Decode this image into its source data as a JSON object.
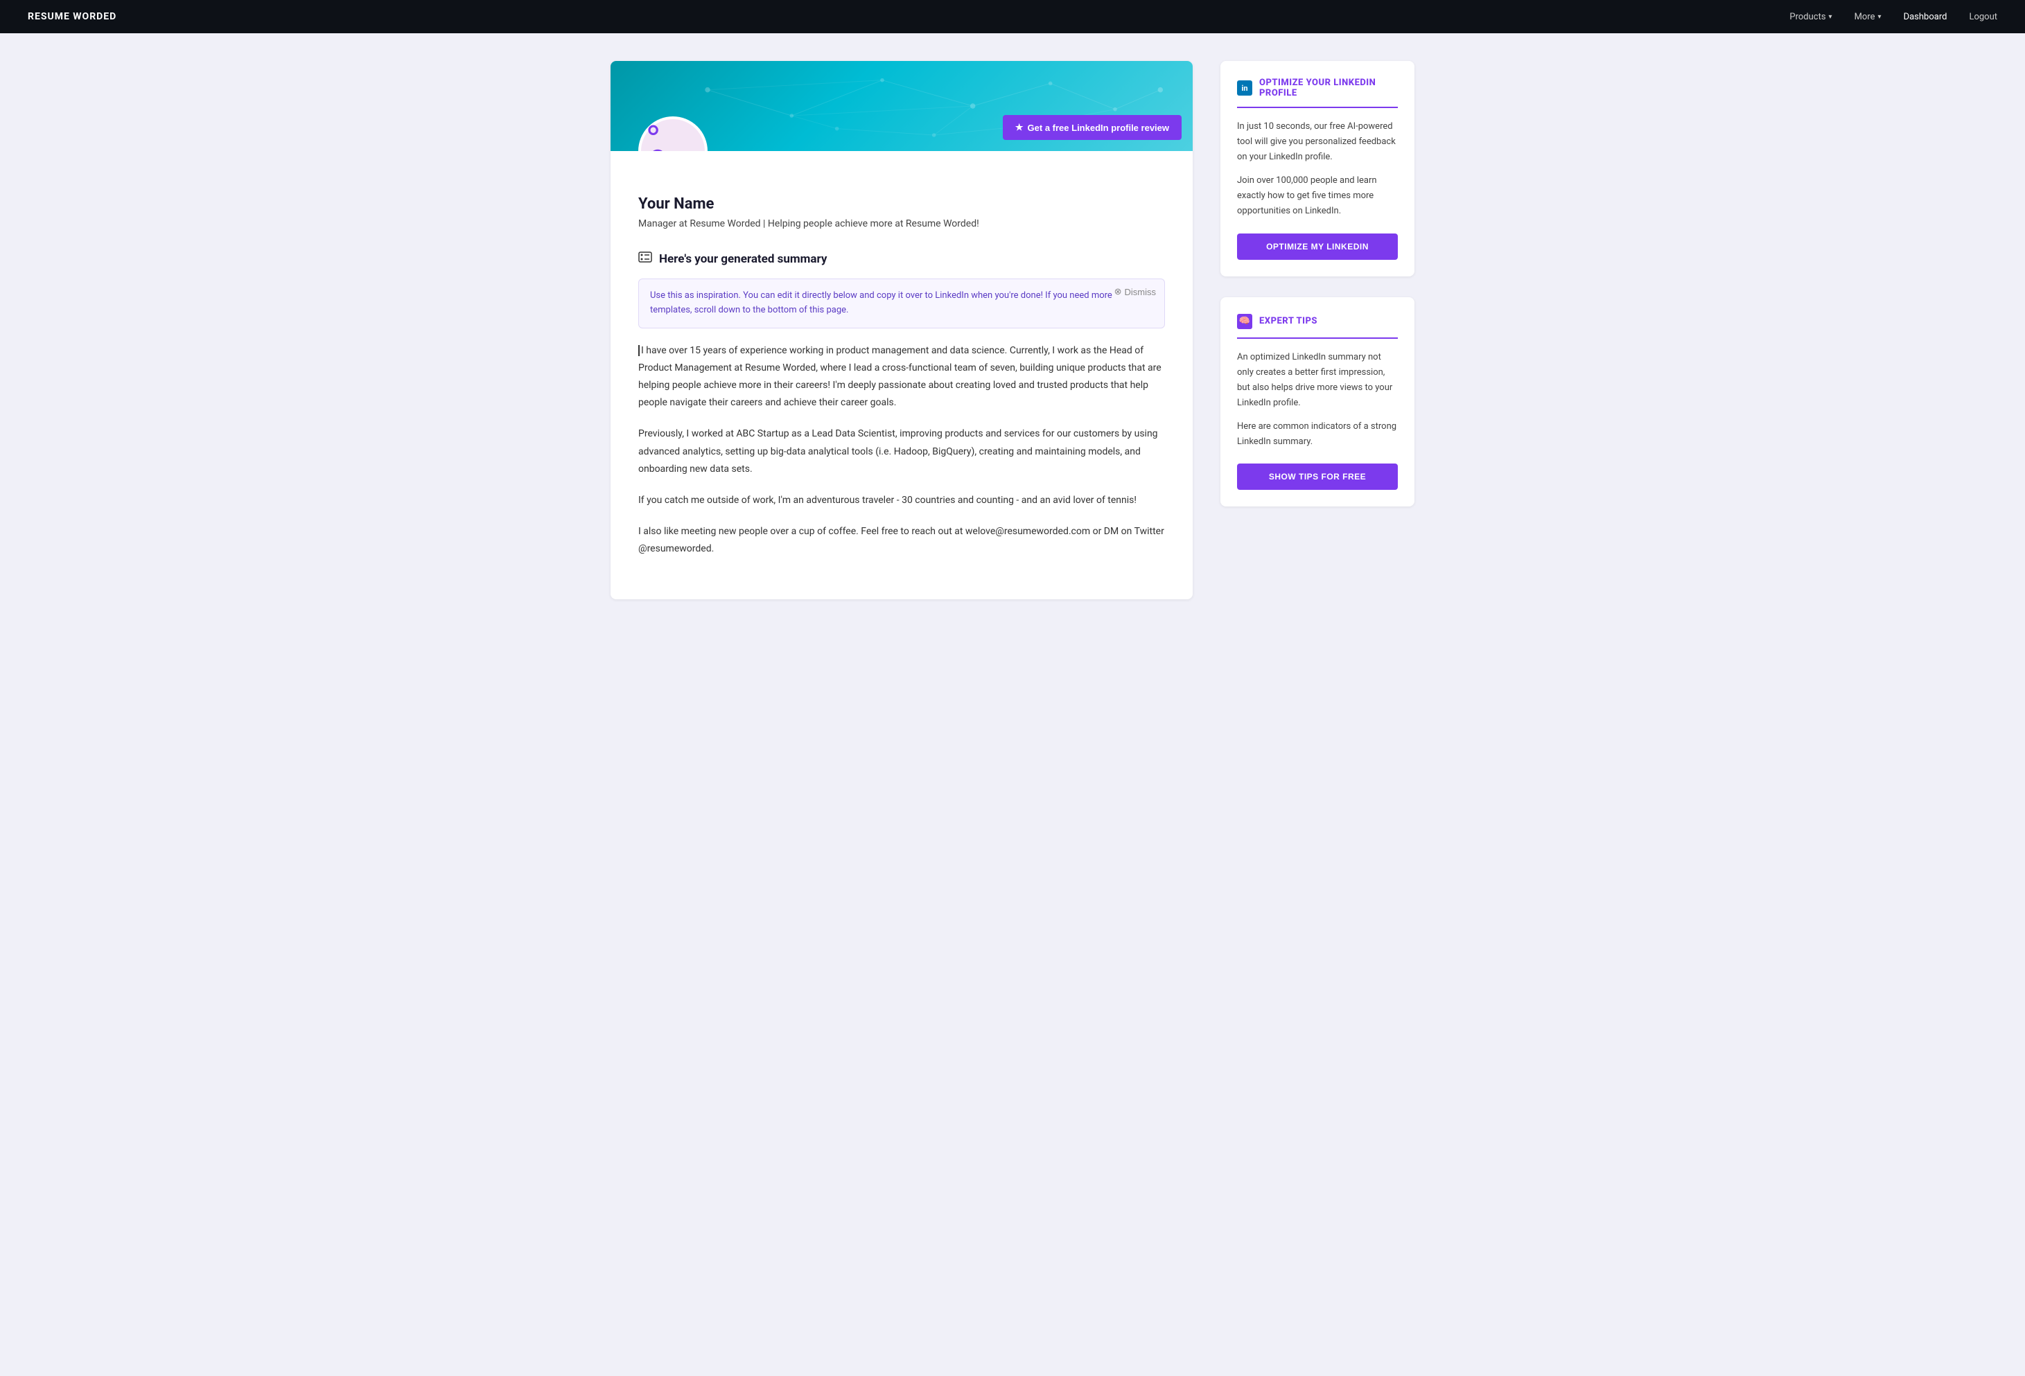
{
  "brand": "RESUME WORDED",
  "nav": {
    "products_label": "Products",
    "more_label": "More",
    "dashboard_label": "Dashboard",
    "logout_label": "Logout"
  },
  "profile": {
    "name": "Your Name",
    "headline": "Manager at Resume Worded | Helping people achieve more at Resume Worded!",
    "review_btn": "Get a free LinkedIn profile review"
  },
  "summary": {
    "heading": "Here's your generated summary",
    "info_text": "Use this as inspiration. You can edit it directly below and copy it over to LinkedIn when you're done! If you need more templates, scroll down to the bottom of this page.",
    "dismiss_label": "Dismiss",
    "paragraphs": [
      "I have over 15 years of experience working in product management and data science. Currently, I work as the Head of Product Management at Resume Worded, where I lead a cross-functional team of seven, building unique products that are helping people achieve more in their careers! I'm deeply passionate about creating loved and trusted products that help people navigate their careers and achieve their career goals.",
      "Previously, I worked at ABC Startup as a Lead Data Scientist, improving products and services for our customers by using advanced analytics, setting up big-data analytical tools (i.e. Hadoop, BigQuery), creating and maintaining models, and onboarding new data sets.",
      "If you catch me outside of work, I'm an adventurous traveler - 30 countries and counting - and an avid lover of tennis!",
      "I also like meeting new people over a cup of coffee. Feel free to reach out at welove@resumeworded.com or DM on Twitter @resumeworded."
    ]
  },
  "sidebar": {
    "linkedin_card": {
      "title": "OPTIMIZE YOUR LINKEDIN PROFILE",
      "body1": "In just 10 seconds, our free AI-powered tool will give you personalized feedback on your LinkedIn profile.",
      "body2": "Join over 100,000 people and learn exactly how to get five times more opportunities on LinkedIn.",
      "cta_label": "OPTIMIZE MY LINKEDIN"
    },
    "tips_card": {
      "title": "EXPERT TIPS",
      "body1": "An optimized LinkedIn summary not only creates a better first impression, but also helps drive more views to your LinkedIn profile.",
      "body2": "Here are common indicators of a strong LinkedIn summary.",
      "cta_label": "SHOW TIPS FOR FREE"
    }
  }
}
